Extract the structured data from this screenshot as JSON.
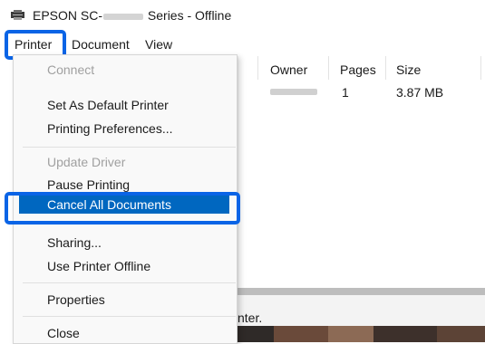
{
  "window": {
    "title_prefix": "EPSON SC-",
    "title_suffix": "Series - Offline"
  },
  "menubar": {
    "items": [
      "Printer",
      "Document",
      "View"
    ]
  },
  "dropdown": {
    "items": [
      {
        "label": "Connect",
        "enabled": false
      },
      {
        "label": "Set As Default Printer",
        "enabled": true
      },
      {
        "label": "Printing Preferences...",
        "enabled": true
      },
      {
        "label": "Update Driver",
        "enabled": false
      },
      {
        "label": "Pause Printing",
        "enabled": true
      },
      {
        "label": "Cancel All Documents",
        "enabled": true,
        "highlighted": true
      },
      {
        "label": "Sharing...",
        "enabled": true
      },
      {
        "label": "Use Printer Offline",
        "enabled": true
      },
      {
        "label": "Properties",
        "enabled": true
      },
      {
        "label": "Close",
        "enabled": true
      }
    ]
  },
  "queue": {
    "columns": [
      "Owner",
      "Pages",
      "Size"
    ],
    "rows": [
      {
        "pages": "1",
        "size": "3.87 MB"
      }
    ]
  },
  "status_text": "nter.",
  "colors": {
    "accent": "#0067c0",
    "callout": "#0a64e6"
  }
}
